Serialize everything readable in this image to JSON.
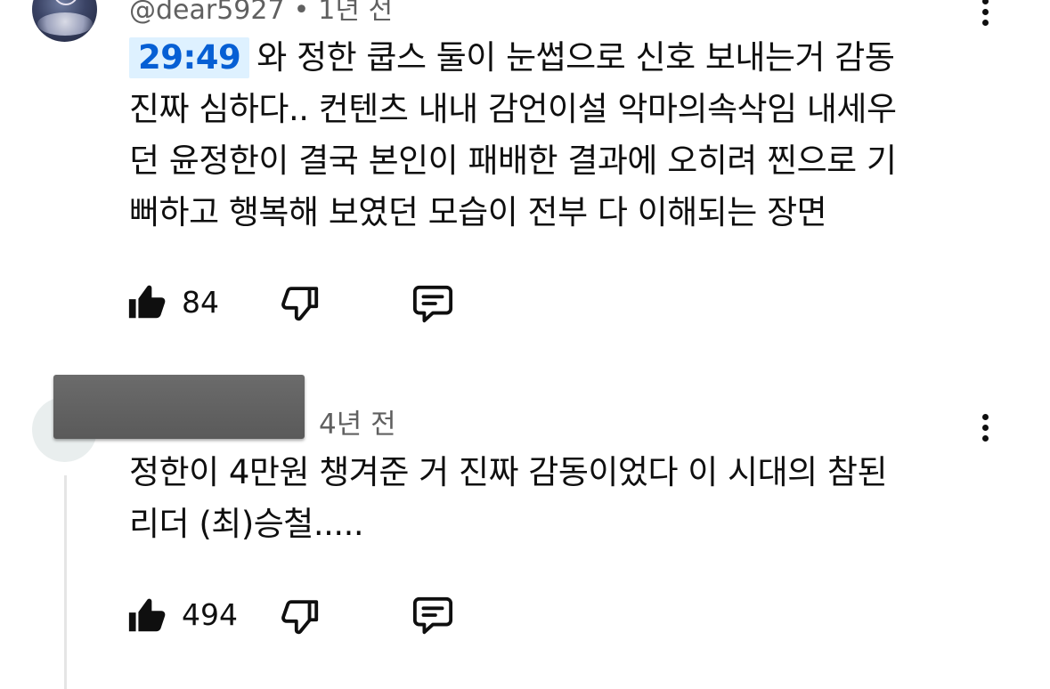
{
  "comments": [
    {
      "handle": "@dear5927",
      "separator": "•",
      "age": "1년 전",
      "timestamp": "29:49",
      "first_line": "와 정한 쿱스 둘이 눈썹으로 신호 보내는거 감동",
      "lines": [
        "진짜 심하다.. 컨텐츠 내내 감언이설 악마의속삭임 내세우",
        "던 윤정한이 결국 본인이 패배한 결과에 오히려 찐으로 기",
        "뻐하고 행복해 보였던 모습이 전부 다 이해되는 장면"
      ],
      "likes": "84"
    },
    {
      "age": "4년 전",
      "lines": [
        "정한이 4만원 챙겨준 거 진짜 감동이었다 이 시대의 참된",
        "리더 (최)승철....."
      ],
      "likes": "494"
    }
  ],
  "icons": {
    "like": "thumbs-up-icon",
    "dislike": "thumbs-down-icon",
    "reply": "reply-icon",
    "menu": "more-vertical-icon"
  },
  "colors": {
    "timestamp_bg": "#def1ff",
    "timestamp_text": "#065fd4",
    "secondary_text": "#606060"
  }
}
